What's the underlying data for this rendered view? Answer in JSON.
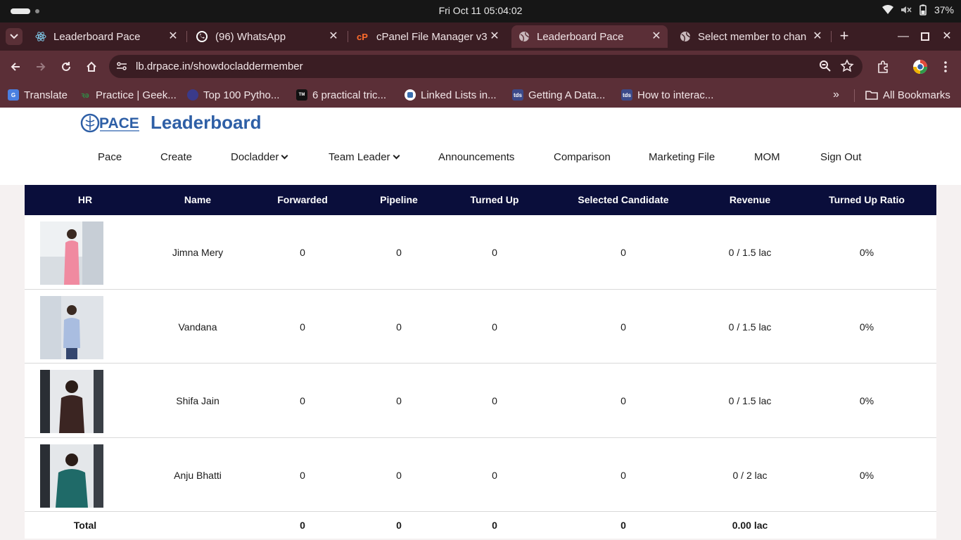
{
  "os": {
    "clock": "Fri Oct 11  05:04:02",
    "battery": "37%"
  },
  "browser": {
    "tabs": [
      {
        "title": "Leaderboard Pace",
        "icon": "react-icon",
        "active": false
      },
      {
        "title": "(96) WhatsApp",
        "icon": "whatsapp-icon",
        "active": false
      },
      {
        "title": "cPanel File Manager v3",
        "icon": "cpanel-icon",
        "active": false
      },
      {
        "title": "Leaderboard Pace",
        "icon": "globe-icon",
        "active": true
      },
      {
        "title": "Select member to chan",
        "icon": "globe-icon",
        "active": false
      }
    ],
    "url": "lb.drpace.in/showdocladdermember",
    "bookmarks": [
      {
        "label": "Translate",
        "icon": "google-translate-icon"
      },
      {
        "label": "Practice | Geek...",
        "icon": "geeksforgeeks-icon"
      },
      {
        "label": "Top 100 Pytho...",
        "icon": "python-icon"
      },
      {
        "label": "6 practical tric...",
        "icon": "medium-icon"
      },
      {
        "label": "Linked Lists in...",
        "icon": "python-icon"
      },
      {
        "label": "Getting A Data...",
        "icon": "tds-icon"
      },
      {
        "label": "How to interac...",
        "icon": "tds-icon"
      }
    ],
    "all_bookmarks": "All Bookmarks"
  },
  "site": {
    "logo_text": "PACE",
    "title": "Leaderboard",
    "nav": [
      {
        "label": "Pace",
        "dropdown": false
      },
      {
        "label": "Create",
        "dropdown": false
      },
      {
        "label": "Docladder",
        "dropdown": true
      },
      {
        "label": "Team Leader",
        "dropdown": true
      },
      {
        "label": "Announcements",
        "dropdown": false
      },
      {
        "label": "Comparison",
        "dropdown": false
      },
      {
        "label": "Marketing File",
        "dropdown": false
      },
      {
        "label": "MOM",
        "dropdown": false
      },
      {
        "label": "Sign Out",
        "dropdown": false
      }
    ]
  },
  "table": {
    "headers": [
      "HR",
      "Name",
      "Forwarded",
      "Pipeline",
      "Turned Up",
      "Selected Candidate",
      "Revenue",
      "Turned Up Ratio"
    ],
    "rows": [
      {
        "name": "Jimna Mery",
        "forwarded": "0",
        "pipeline": "0",
        "turned_up": "0",
        "selected": "0",
        "revenue": "0 / 1.5 lac",
        "ratio": "0%"
      },
      {
        "name": "Vandana",
        "forwarded": "0",
        "pipeline": "0",
        "turned_up": "0",
        "selected": "0",
        "revenue": "0 / 1.5 lac",
        "ratio": "0%"
      },
      {
        "name": "Shifa Jain",
        "forwarded": "0",
        "pipeline": "0",
        "turned_up": "0",
        "selected": "0",
        "revenue": "0 / 1.5 lac",
        "ratio": "0%"
      },
      {
        "name": "Anju Bhatti",
        "forwarded": "0",
        "pipeline": "0",
        "turned_up": "0",
        "selected": "0",
        "revenue": "0 / 2 lac",
        "ratio": "0%"
      }
    ],
    "total": {
      "label": "Total",
      "forwarded": "0",
      "pipeline": "0",
      "turned_up": "0",
      "selected": "0",
      "revenue": "0.00 lac"
    }
  },
  "colors": {
    "tab_strip": "#3a1d23",
    "toolbar": "#5b2f37",
    "table_header": "#0a0e3b",
    "brand_blue": "#2e5fa6"
  }
}
